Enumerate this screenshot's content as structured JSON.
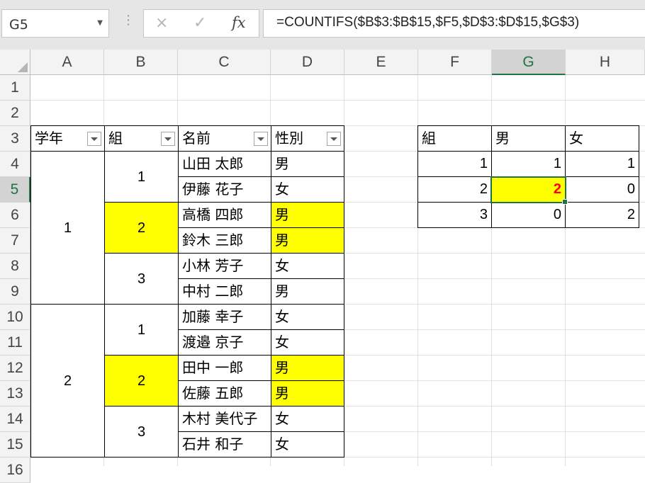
{
  "name_box": "G5",
  "formula_bar": {
    "cancel_icon": "×",
    "enter_icon": "✓",
    "fx_label": "fx",
    "formula": "=COUNTIFS($B$3:$B$15,$F5,$D$3:$D$15,$G$3)"
  },
  "columns": [
    "A",
    "B",
    "C",
    "D",
    "E",
    "F",
    "G",
    "H"
  ],
  "selected_column": "G",
  "rows": [
    "1",
    "2",
    "3",
    "4",
    "5",
    "6",
    "7",
    "8",
    "9",
    "10",
    "11",
    "12",
    "13",
    "14",
    "15",
    "16"
  ],
  "selected_row": "5",
  "main_table": {
    "headers": [
      "学年",
      "組",
      "名前",
      "性別"
    ],
    "grades": [
      "1",
      "2"
    ],
    "classes": [
      "1",
      "2",
      "3",
      "1",
      "2",
      "3"
    ],
    "records": [
      {
        "name": "山田 太郎",
        "gender": "男"
      },
      {
        "name": "伊藤 花子",
        "gender": "女"
      },
      {
        "name": "高橋 四郎",
        "gender": "男"
      },
      {
        "name": "鈴木 三郎",
        "gender": "男"
      },
      {
        "name": "小林 芳子",
        "gender": "女"
      },
      {
        "name": "中村 二郎",
        "gender": "男"
      },
      {
        "name": "加藤 幸子",
        "gender": "女"
      },
      {
        "name": "渡邉 京子",
        "gender": "女"
      },
      {
        "name": "田中 一郎",
        "gender": "男"
      },
      {
        "name": "佐藤 五郎",
        "gender": "男"
      },
      {
        "name": "木村 美代子",
        "gender": "女"
      },
      {
        "name": "石井 和子",
        "gender": "女"
      }
    ]
  },
  "summary_table": {
    "headers": [
      "組",
      "男",
      "女"
    ],
    "rows": [
      [
        "1",
        "1",
        "1"
      ],
      [
        "2",
        "2",
        "0"
      ],
      [
        "3",
        "0",
        "2"
      ]
    ]
  },
  "colors": {
    "highlight": "#ffff00",
    "accent_green": "#217346",
    "result_red": "#ff0000"
  }
}
